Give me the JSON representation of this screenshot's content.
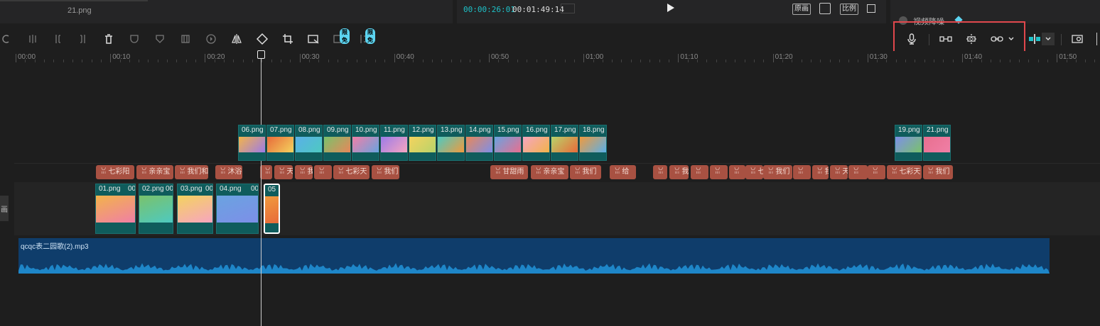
{
  "media_panel": {
    "file_name": "21.png"
  },
  "player": {
    "current_time": "00:00:26:01",
    "duration": "00:01:49:14",
    "buttons": [
      "原画",
      "比例"
    ]
  },
  "side_panel": {
    "partial_text": "视频降噪"
  },
  "toolbar": {
    "badges": [
      "限免",
      "限免"
    ]
  },
  "ruler": {
    "labels": [
      "00:00",
      "00:10",
      "00:20",
      "00:30",
      "00:40",
      "00:50",
      "01:00",
      "01:10",
      "01:20",
      "01:30",
      "01:40",
      "01:50"
    ]
  },
  "tracks": {
    "overlay_clips": [
      "06.png",
      "07.png",
      "08.png",
      "09.png",
      "10.png",
      "11.png",
      "12.png",
      "13.png",
      "14.png",
      "15.png",
      "16.png",
      "17.png",
      "18.png",
      "19.png",
      "21.png"
    ],
    "main_clips": [
      "01.png",
      "02.png",
      "03.png",
      "04.png",
      "05"
    ],
    "main_clip_suffix": "00",
    "subtitles": [
      "七彩阳",
      "亲亲宝",
      "我们和",
      "沐浴",
      "",
      "天",
      "我",
      "",
      "七彩天",
      "我们",
      "甘甜雨",
      "亲亲宝",
      "我们",
      "给",
      "",
      "我",
      "",
      "",
      "",
      "七彩体",
      "我们",
      "",
      "我",
      "天",
      "",
      "",
      "七彩天",
      "我们"
    ],
    "audio_name": "qcqc表二园歌(2).mp3",
    "side_label": "画"
  },
  "colors": {
    "accent": "#1ec1c8",
    "highlight_box": "#e0474c",
    "clip_teal": "#0f5c5c",
    "subtitle": "#a85142",
    "audio": "#0f3d6b"
  }
}
